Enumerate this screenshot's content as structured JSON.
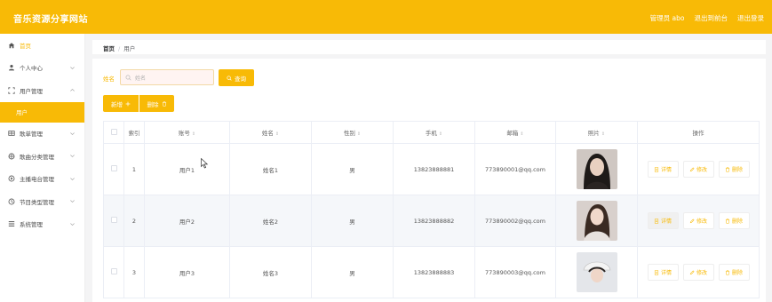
{
  "header": {
    "title": "音乐资源分享网站",
    "admin_label": "管理员 abo",
    "back_label": "退出到前台",
    "logout_label": "退出登录"
  },
  "sidebar": {
    "items": [
      {
        "label": "首页",
        "icon": "home-icon"
      },
      {
        "label": "个人中心",
        "icon": "user-icon"
      },
      {
        "label": "用户管理",
        "icon": "user-manage-icon"
      },
      {
        "label": "用户",
        "icon": ""
      },
      {
        "label": "歌单管理",
        "icon": "playlist-icon"
      },
      {
        "label": "歌曲分类管理",
        "icon": "category-icon"
      },
      {
        "label": "主播电台管理",
        "icon": "radio-icon"
      },
      {
        "label": "节目类型管理",
        "icon": "program-icon"
      },
      {
        "label": "系统管理",
        "icon": "system-icon"
      }
    ]
  },
  "breadcrumb": {
    "home": "首页",
    "separator": "/",
    "current": "用户"
  },
  "search": {
    "label": "姓名",
    "placeholder": "姓名",
    "query_button": "查询"
  },
  "toolbar": {
    "add_label": "新增",
    "delete_label": "删除"
  },
  "table": {
    "columns": {
      "index": "索引",
      "account": "账号",
      "name": "姓名",
      "gender": "性别",
      "phone": "手机",
      "email": "邮箱",
      "photo": "照片",
      "actions": "操作"
    },
    "rows": [
      {
        "index": "1",
        "account": "用户1",
        "name": "姓名1",
        "gender": "男",
        "phone": "13823888881",
        "email": "773890001@qq.com"
      },
      {
        "index": "2",
        "account": "用户2",
        "name": "姓名2",
        "gender": "男",
        "phone": "13823888882",
        "email": "773890002@qq.com"
      },
      {
        "index": "3",
        "account": "用户3",
        "name": "姓名3",
        "gender": "男",
        "phone": "13823888883",
        "email": "773890003@qq.com"
      }
    ],
    "action_labels": {
      "detail": "详情",
      "edit": "修改",
      "delete": "删除"
    }
  },
  "colors": {
    "accent": "#f8ba06",
    "header_bg": "#f8ba06",
    "row_alt": "#f5f7fa"
  }
}
